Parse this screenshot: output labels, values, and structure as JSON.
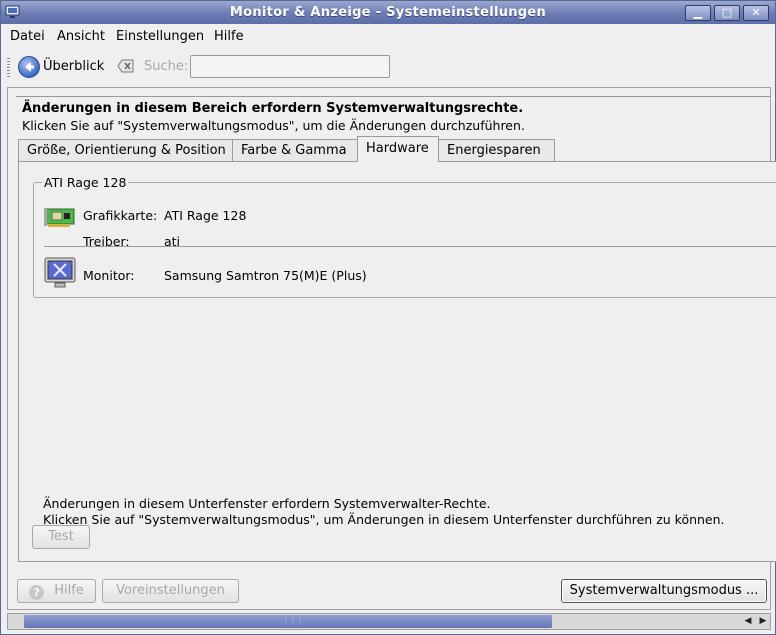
{
  "window": {
    "title": "Monitor & Anzeige - Systemeinstellungen",
    "controls": [
      "▁",
      "□",
      "✕"
    ]
  },
  "menubar": {
    "items": [
      "Datei",
      "Ansicht",
      "Einstellungen",
      "Hilfe"
    ]
  },
  "toolbar": {
    "back_label": "Überblick",
    "search_label": "Suche:",
    "search_value": ""
  },
  "notice": {
    "title": "Änderungen in diesem Bereich erfordern Systemverwaltungsrechte.",
    "text": "Klicken Sie auf \"Systemverwaltungsmodus\", um die Änderungen durchzuführen."
  },
  "tabs": [
    {
      "label": "Größe, Orientierung & Position",
      "active": false
    },
    {
      "label": "Farbe & Gamma",
      "active": false
    },
    {
      "label": "Hardware",
      "active": true
    },
    {
      "label": "Energiesparen",
      "active": false
    }
  ],
  "hardware": {
    "group_title": "ATI Rage 128",
    "graphics_label": "Grafikkarte:",
    "graphics_value": "ATI Rage 128",
    "driver_label": "Treiber:",
    "driver_value": "ati",
    "monitor_label": "Monitor:",
    "monitor_value": "Samsung Samtron 75(M)E (Plus)"
  },
  "panel_note": {
    "line1": "Änderungen in diesem Unterfenster erfordern Systemverwalter-Rechte.",
    "line2": "Klicken Sie auf \"Systemverwaltungsmodus\", um Änderungen in diesem Unterfenster durchführen zu können.",
    "test_button": "Test"
  },
  "buttons": {
    "help": "Hilfe",
    "defaults": "Voreinstellungen",
    "admin_mode": "Systemverwaltungsmodus ..."
  },
  "colors": {
    "titlebar": "#6c7cb4",
    "accent": "#3d68c4"
  }
}
